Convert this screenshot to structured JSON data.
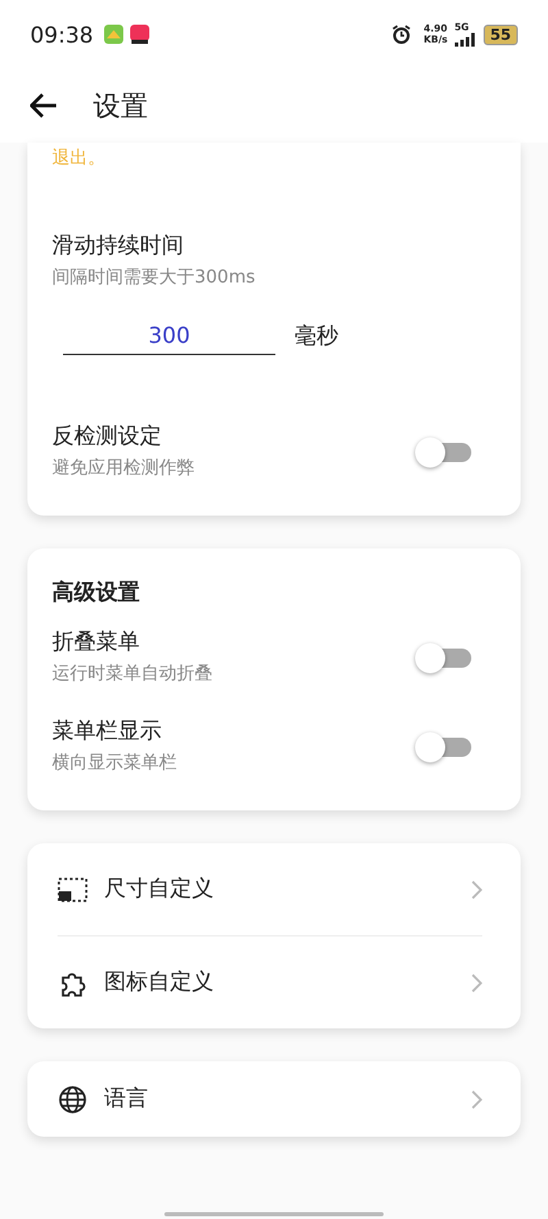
{
  "status_bar": {
    "time": "09:38",
    "net_speed": "4.90",
    "net_unit": "KB/s",
    "network": "5G",
    "battery": "55"
  },
  "header": {
    "title": "设置"
  },
  "general_card": {
    "note": "退出。",
    "duration": {
      "title": "滑动持续时间",
      "subtitle": "间隔时间需要大于300ms",
      "value": "300",
      "unit": "毫秒"
    },
    "toggles": [
      {
        "title": "反检测设定",
        "subtitle": "避免应用检测作弊",
        "on": false
      }
    ]
  },
  "advanced_card": {
    "title": "高级设置",
    "toggles": [
      {
        "title": "折叠菜单",
        "subtitle": "运行时菜单自动折叠",
        "on": false
      },
      {
        "title": "菜单栏显示",
        "subtitle": "横向显示菜单栏",
        "on": false
      }
    ]
  },
  "custom_card": {
    "items": [
      {
        "kind": "size",
        "label": "尺寸自定义"
      },
      {
        "kind": "icon",
        "label": "图标自定义"
      }
    ]
  },
  "language_card": {
    "items": [
      {
        "kind": "globe",
        "label": "语言"
      }
    ]
  }
}
